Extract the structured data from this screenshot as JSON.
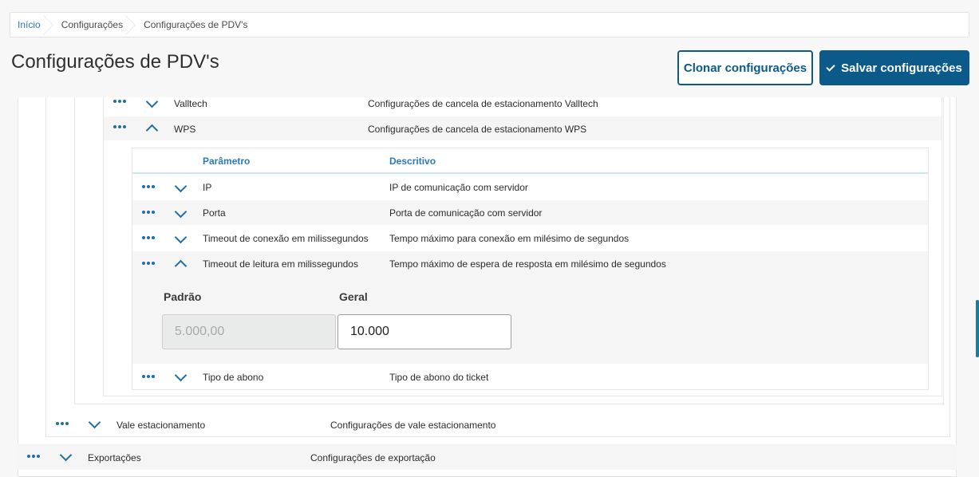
{
  "breadcrumb": [
    "Início",
    "Configurações",
    "Configurações de PDV's"
  ],
  "page_title": "Configurações de PDV's",
  "actions": {
    "clone_label": "Clonar configurações",
    "save_label": "Salvar configurações"
  },
  "rows_level4": [
    {
      "name": "Valltech",
      "description": "Configurações de cancela de estacionamento Valltech",
      "expanded": false
    },
    {
      "name": "WPS",
      "description": "Configurações de cancela de estacionamento WPS",
      "expanded": true
    }
  ],
  "param_table": {
    "headers": [
      "Parâmetro",
      "Descritivo"
    ],
    "rows": [
      {
        "name": "IP",
        "description": "IP de comunicação com servidor",
        "expanded": false
      },
      {
        "name": "Porta",
        "description": "Porta de comunicação com servidor",
        "expanded": false
      },
      {
        "name": "Timeout de conexão em milissegundos",
        "description": "Tempo máximo para conexão em milésimo de segundos",
        "expanded": false
      },
      {
        "name": "Timeout de leitura em milissegundos",
        "description": "Tempo máximo de espera de resposta em milésimo de segundos",
        "expanded": true
      },
      {
        "name": "Tipo de abono",
        "description": "Tipo de abono do ticket",
        "expanded": false
      }
    ],
    "detail": {
      "default_label": "Padrão",
      "default_value": "5.000,00",
      "general_label": "Geral",
      "general_value": "10.000"
    }
  },
  "row_level2": {
    "name": "Vale estacionamento",
    "description": "Configurações de vale estacionamento"
  },
  "row_level1": {
    "name": "Exportações",
    "description": "Configurações de exportação"
  },
  "colors": {
    "primary": "#0c5a8a",
    "link": "#2a7ab8",
    "icon": "#1f6fa5"
  }
}
